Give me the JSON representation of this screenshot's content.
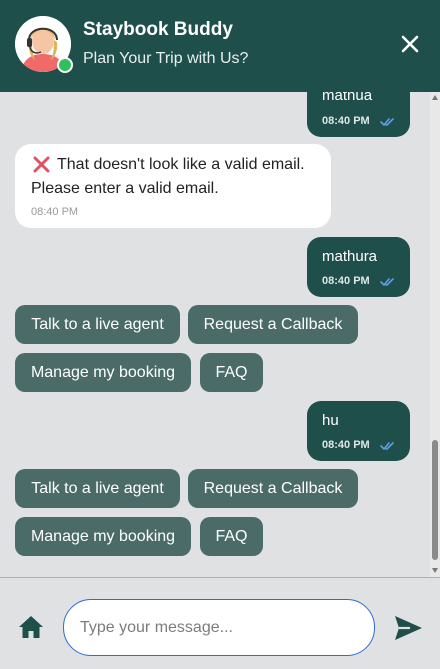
{
  "header": {
    "title": "Staybook Buddy",
    "subtitle": "Plan Your Trip with Us?"
  },
  "messages": {
    "m1": {
      "text": "mathua",
      "time": "08:40 PM"
    },
    "bot1": {
      "icon": "cross-mark-icon",
      "line1": "That doesn't look like a valid email.",
      "line2": "Please enter a valid email.",
      "time": "08:40 PM"
    },
    "m2": {
      "text": "mathura",
      "time": "08:40 PM"
    },
    "m3": {
      "text": "hu",
      "time": "08:40 PM"
    }
  },
  "quick_replies_1": {
    "talk": "Talk to a live agent",
    "callback": "Request a Callback",
    "manage": "Manage my booking",
    "faq": "FAQ"
  },
  "quick_replies_2": {
    "talk": "Talk to a live agent",
    "callback": "Request a Callback",
    "manage": "Manage my booking",
    "faq": "FAQ"
  },
  "composer": {
    "placeholder": "Type your message..."
  },
  "colors": {
    "header_bg": "#1f4f4b",
    "user_bubble": "#1f4f4b",
    "quick_reply_bg": "#4a6b68",
    "read_tick": "#5fa2e0",
    "online": "#2ec05a"
  }
}
